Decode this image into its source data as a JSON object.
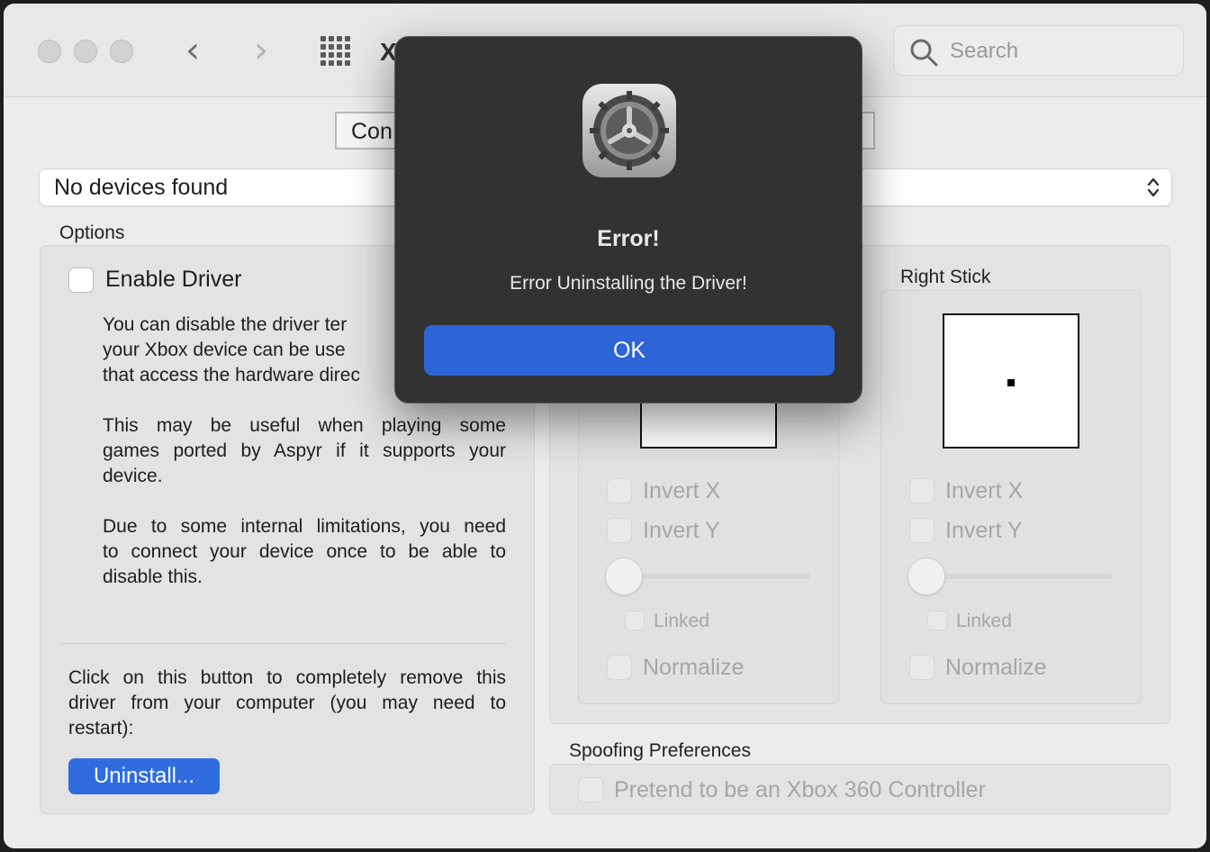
{
  "window": {
    "title": "X",
    "nav": {
      "back": "‹",
      "forward": "›"
    },
    "search": {
      "placeholder": "Search"
    }
  },
  "tabs": {
    "visible_label": "Con"
  },
  "device_popup": {
    "selected": "No devices found"
  },
  "options": {
    "title": "Options",
    "enable_driver_label": "Enable Driver",
    "enable_driver_checked": false,
    "para1": [
      "You can disable the driver ter",
      "your Xbox device can be use",
      "that access the hardware direc"
    ],
    "para2": [
      "This may be useful when playing some",
      "games ported by Aspyr if it supports your",
      "device."
    ],
    "para3": [
      "Due to some internal limitations, you need",
      "to connect your device once to be able to",
      "disable this."
    ],
    "uninstall_text": [
      "Click on this button to completely remove this",
      "driver from your computer (you may need to",
      "restart):"
    ],
    "uninstall_button": "Uninstall..."
  },
  "left_stick": {
    "invert_x": "Invert X",
    "invert_y": "Invert Y",
    "linked": "Linked",
    "normalize": "Normalize",
    "deadzone": 0
  },
  "right_stick": {
    "title": "Right Stick",
    "invert_x": "Invert X",
    "invert_y": "Invert Y",
    "linked": "Linked",
    "normalize": "Normalize",
    "deadzone": 0
  },
  "spoofing": {
    "title": "Spoofing Preferences",
    "pretend_label": "Pretend to be an Xbox 360 Controller"
  },
  "dialog": {
    "icon": "system-preferences-gear-icon",
    "title": "Error!",
    "message": "Error Uninstalling the Driver!",
    "ok_button": "OK"
  },
  "colors": {
    "accent_blue": "#2d64d6",
    "dialog_bg": "#323232",
    "window_bg": "#ececec"
  }
}
